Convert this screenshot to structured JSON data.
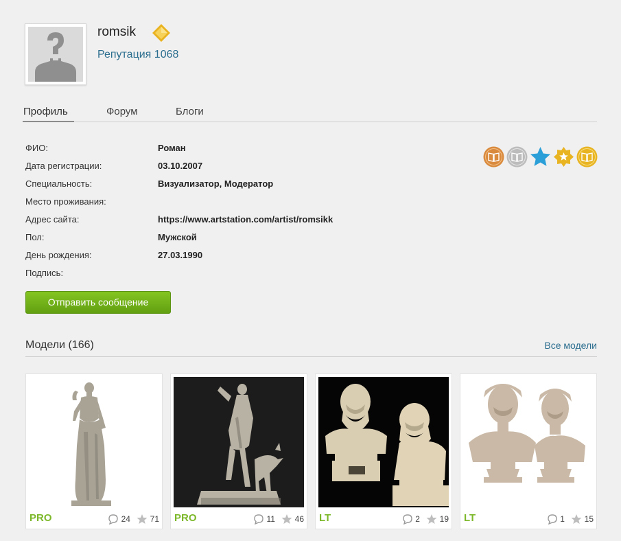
{
  "profile": {
    "username": "romsik",
    "reputation": "Репутация 1068"
  },
  "tabs": [
    {
      "label": "Профиль",
      "active": true
    },
    {
      "label": "Форум",
      "active": false
    },
    {
      "label": "Блоги",
      "active": false
    }
  ],
  "info": [
    {
      "label": "ФИО:",
      "value": "Роман"
    },
    {
      "label": "Дата регистрации:",
      "value": "03.10.2007"
    },
    {
      "label": "Специальность:",
      "value": "Визуализатор, Модератор"
    },
    {
      "label": "Место проживания:",
      "value": ""
    },
    {
      "label": "Адрес сайта:",
      "value": "https://www.artstation.com/artist/romsikk"
    },
    {
      "label": "Пол:",
      "value": "Мужской"
    },
    {
      "label": "День рождения:",
      "value": "27.03.1990"
    },
    {
      "label": "Подпись:",
      "value": ""
    }
  ],
  "badges": [
    {
      "icon": "book-badge-icon",
      "color": "#d98a3d"
    },
    {
      "icon": "book-badge-icon",
      "color": "#bcbcbc"
    },
    {
      "icon": "star-badge-icon",
      "color": "#2a9fd8"
    },
    {
      "icon": "sheriff-badge-icon",
      "color": "#e8b422"
    },
    {
      "icon": "book-badge-icon",
      "color": "#e8b422"
    }
  ],
  "send_button": "Отправить сообщение",
  "models": {
    "title": "Модели (166)",
    "all_link": "Все модели",
    "items": [
      {
        "tier": "PRO",
        "comments": "24",
        "stars": "71",
        "bg": "#ffffff"
      },
      {
        "tier": "PRO",
        "comments": "11",
        "stars": "46",
        "bg": "#1c1c1c"
      },
      {
        "tier": "LT",
        "comments": "2",
        "stars": "19",
        "bg": "#050505"
      },
      {
        "tier": "LT",
        "comments": "1",
        "stars": "15",
        "bg": "#ffffff"
      }
    ]
  },
  "colors": {
    "link": "#2c6e8f",
    "accent_green": "#7cb82a",
    "background": "#f0f0f0"
  }
}
